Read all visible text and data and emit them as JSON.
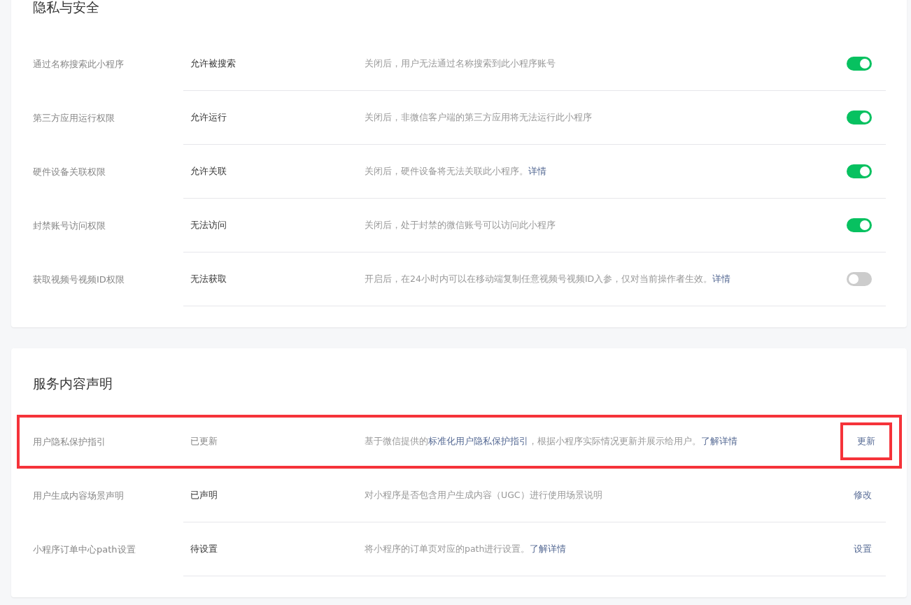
{
  "sections": [
    {
      "title": "隐私与安全",
      "rows": [
        {
          "label": "通过名称搜索此小程序",
          "value": "允许被搜索",
          "value_greyed": false,
          "highlighted": false,
          "description": [
            {
              "kind": "text",
              "text": "关闭后，用户无法通过名称搜索到此小程序账号"
            }
          ],
          "action": {
            "kind": "toggle",
            "on": true
          }
        },
        {
          "label": "第三方应用运行权限",
          "value": "允许运行",
          "value_greyed": false,
          "highlighted": false,
          "description": [
            {
              "kind": "text",
              "text": "关闭后，非微信客户端的第三方应用将无法运行此小程序"
            }
          ],
          "action": {
            "kind": "toggle",
            "on": true
          }
        },
        {
          "label": "硬件设备关联权限",
          "value": "允许关联",
          "value_greyed": false,
          "highlighted": false,
          "description": [
            {
              "kind": "text",
              "text": "关闭后，硬件设备将无法关联此小程序。"
            },
            {
              "kind": "link",
              "text": "详情"
            }
          ],
          "action": {
            "kind": "toggle",
            "on": true
          }
        },
        {
          "label": "封禁账号访问权限",
          "value": "无法访问",
          "value_greyed": false,
          "highlighted": false,
          "description": [
            {
              "kind": "text",
              "text": "关闭后，处于封禁的微信账号可以访问此小程序"
            }
          ],
          "action": {
            "kind": "toggle",
            "on": true
          }
        },
        {
          "label": "获取视频号视频ID权限",
          "value": "无法获取",
          "value_greyed": false,
          "highlighted": false,
          "description": [
            {
              "kind": "text",
              "text": "开启后，在24小时内可以在移动端复制任意视频号视频ID入参，仅对当前操作者生效。"
            },
            {
              "kind": "link",
              "text": "详情"
            }
          ],
          "action": {
            "kind": "toggle",
            "on": false
          }
        }
      ]
    },
    {
      "title": "服务内容声明",
      "rows": [
        {
          "label": "用户隐私保护指引",
          "value": "已更新",
          "value_greyed": true,
          "highlighted": true,
          "description": [
            {
              "kind": "text",
              "text": "基于微信提供的"
            },
            {
              "kind": "link",
              "text": "标准化用户隐私保护指引"
            },
            {
              "kind": "text",
              "text": "，根据小程序实际情况更新并展示给用户。"
            },
            {
              "kind": "link",
              "text": "了解详情"
            }
          ],
          "action": {
            "kind": "link",
            "text": "更新",
            "highlighted": true
          }
        },
        {
          "label": "用户生成内容场景声明",
          "value": "已声明",
          "value_greyed": false,
          "highlighted": false,
          "description": [
            {
              "kind": "text",
              "text": "对小程序是否包含用户生成内容（UGC）进行使用场景说明"
            }
          ],
          "action": {
            "kind": "link",
            "text": "修改",
            "highlighted": false
          }
        },
        {
          "label": "小程序订单中心path设置",
          "value": "待设置",
          "value_greyed": false,
          "highlighted": false,
          "description": [
            {
              "kind": "text",
              "text": "将小程序的订单页对应的path进行设置。"
            },
            {
              "kind": "link",
              "text": "了解详情"
            }
          ],
          "action": {
            "kind": "link",
            "text": "设置",
            "highlighted": false
          }
        }
      ]
    }
  ]
}
